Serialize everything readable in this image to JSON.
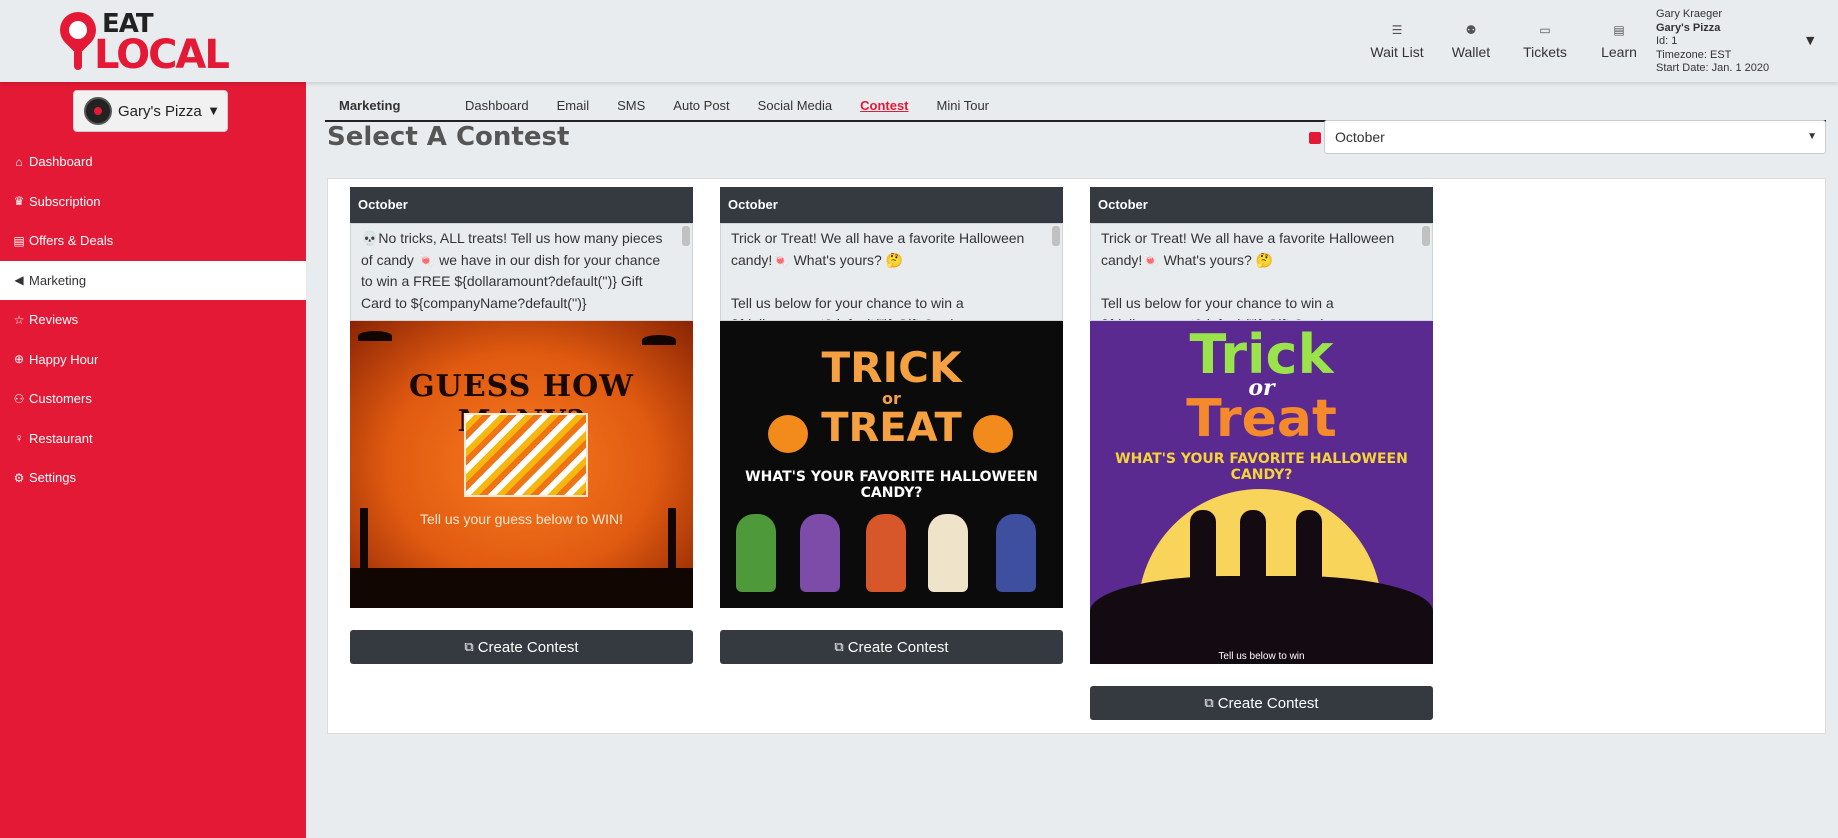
{
  "brand": {
    "line1": "EAT",
    "line2": "LOCAL",
    "accent": "#e41935"
  },
  "top_nav": [
    {
      "icon": "list-icon",
      "glyph": "☰",
      "label": "Wait List"
    },
    {
      "icon": "money-bag-icon",
      "glyph": "⚉",
      "label": "Wallet"
    },
    {
      "icon": "ticket-icon",
      "glyph": "▭",
      "label": "Tickets"
    },
    {
      "icon": "book-icon",
      "glyph": "▤",
      "label": "Learn"
    }
  ],
  "user": {
    "name": "Gary Kraeger",
    "business": "Gary's Pizza",
    "id": "Id: 1",
    "timezone": "Timezone: EST",
    "start_date": "Start Date: Jan. 1 2020"
  },
  "sidebar": {
    "business_select": "Gary's Pizza",
    "items": [
      {
        "label": "Dashboard",
        "icon": "home-icon",
        "glyph": "⌂"
      },
      {
        "label": "Subscription",
        "icon": "crown-icon",
        "glyph": "♛"
      },
      {
        "label": "Offers & Deals",
        "icon": "file-icon",
        "glyph": "▤"
      },
      {
        "label": "Marketing",
        "icon": "megaphone-icon",
        "glyph": "◀"
      },
      {
        "label": "Reviews",
        "icon": "star-icon",
        "glyph": "☆"
      },
      {
        "label": "Happy Hour",
        "icon": "cocktail-icon",
        "glyph": "⊕"
      },
      {
        "label": "Customers",
        "icon": "people-icon",
        "glyph": "⚇"
      },
      {
        "label": "Restaurant",
        "icon": "user-icon",
        "glyph": "♀"
      },
      {
        "label": "Settings",
        "icon": "gear-icon",
        "glyph": "⚙"
      }
    ],
    "active_index": 3
  },
  "subnav": {
    "title": "Marketing",
    "tabs": [
      "Dashboard",
      "Email",
      "SMS",
      "Auto Post",
      "Social Media",
      "Contest",
      "Mini Tour"
    ],
    "active_tab": "Contest"
  },
  "page_title": "Select A Contest",
  "month_filter": {
    "icon": "calendar-icon",
    "value": "October"
  },
  "cards": [
    {
      "header": "October",
      "text": "💀No tricks, ALL treats!  Tell us how many pieces of candy 🍬 we have in our dish for your chance to win a FREE ${dollaramount?default('')} Gift Card to ${companyName?default('')}",
      "image_title": "GUESS HOW MANY?",
      "image_caption": "Tell us your guess below to WIN!",
      "button": "Create Contest"
    },
    {
      "header": "October",
      "text": "Trick or Treat! We all have a favorite Halloween candy!🍬  What's yours? 🤔\n\nTell us below for your chance to win a ${dollaramount?default('')} Gift Card",
      "image_line1": "TRICK",
      "image_line2": "or",
      "image_line3": "TREAT",
      "image_sub": "WHAT'S YOUR FAVORITE HALLOWEEN CANDY?",
      "button": "Create Contest"
    },
    {
      "header": "October",
      "text": "Trick or Treat! We all have a favorite Halloween candy!🍬  What's yours? 🤔\n\nTell us below for your chance to win a ${dollaramount?default('')} Gift Card",
      "image_line1": "Trick",
      "image_line2": "or",
      "image_line3": "Treat",
      "image_sub": "WHAT'S YOUR FAVORITE HALLOWEEN CANDY?",
      "image_caption": "Tell us below to win",
      "button": "Create Contest"
    }
  ]
}
